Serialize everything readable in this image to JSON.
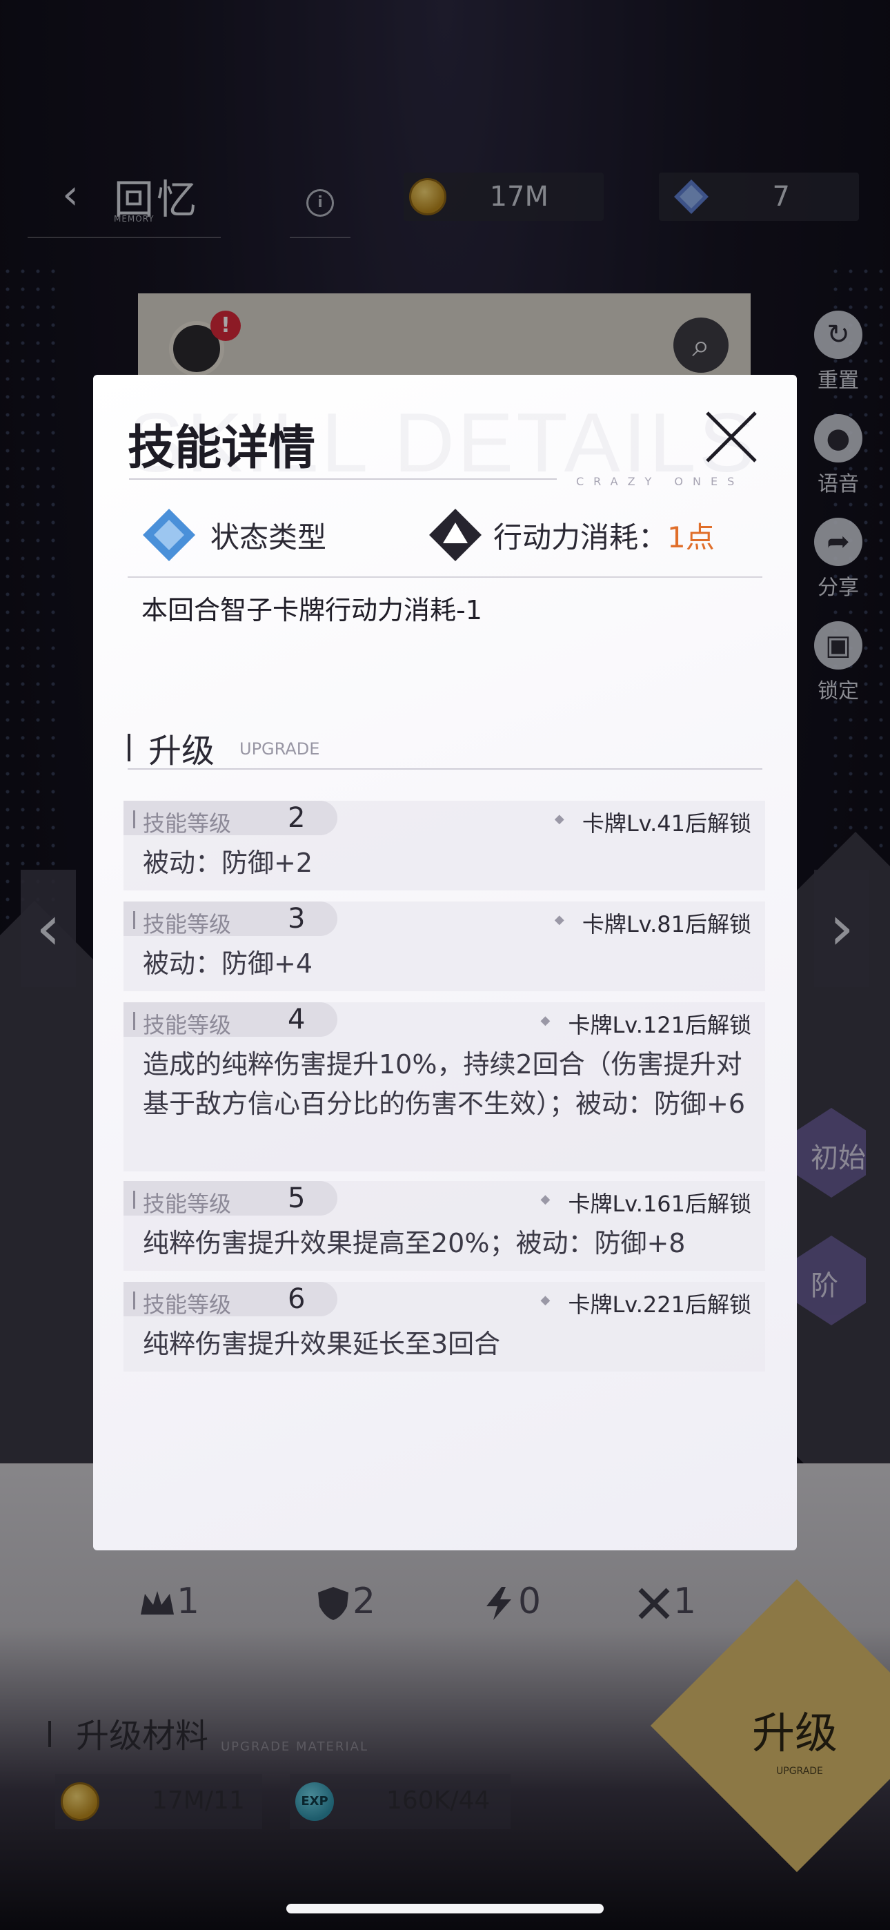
{
  "header": {
    "back_title": "回忆",
    "back_sub": "MEMORY",
    "gold": "17M",
    "gems": "7"
  },
  "side_tools": [
    {
      "label": "重置",
      "icon": "reset-icon"
    },
    {
      "label": "语音",
      "icon": "microphone-icon"
    },
    {
      "label": "分享",
      "icon": "share-icon"
    },
    {
      "label": "锁定",
      "icon": "lock-icon"
    }
  ],
  "hex_buttons": {
    "start": "初始",
    "stage": "阶"
  },
  "stats": {
    "crown": "1",
    "shield": "2",
    "bolt": "0",
    "swords": "1"
  },
  "materials": {
    "title": "升级材料",
    "sub": "UPGRADE MATERIAL",
    "gold": "17M/11",
    "exp": "160K/44",
    "exp_icon_text": "EXP"
  },
  "upgrade_button": {
    "label": "升级",
    "sub": "UPGRADE"
  },
  "modal": {
    "title": "技能详情",
    "watermark": "SKILL DETAILS",
    "sub": "CRAZY ONES",
    "type_label": "状态类型",
    "cost_label": "行动力消耗：",
    "cost_value": "1点",
    "description": "本回合智子卡牌行动力消耗-1",
    "section_title": "升级",
    "section_en": "UPGRADE",
    "levels": [
      {
        "label": "技能等级",
        "level": "2",
        "unlock": "卡牌Lv.41后解锁",
        "text": "被动：防御+2"
      },
      {
        "label": "技能等级",
        "level": "3",
        "unlock": "卡牌Lv.81后解锁",
        "text": "被动：防御+4"
      },
      {
        "label": "技能等级",
        "level": "4",
        "unlock": "卡牌Lv.121后解锁",
        "text": "造成的纯粹伤害提升10%，持续2回合（伤害提升对基于敌方信心百分比的伤害不生效）；被动：防御+6"
      },
      {
        "label": "技能等级",
        "level": "5",
        "unlock": "卡牌Lv.161后解锁",
        "text": "纯粹伤害提升效果提高至20%；被动：防御+8"
      },
      {
        "label": "技能等级",
        "level": "6",
        "unlock": "卡牌Lv.221后解锁",
        "text": "纯粹伤害提升效果延长至3回合"
      }
    ]
  },
  "colors": {
    "accent": "#e06e2a",
    "modal_bg": "#ffffff",
    "type_icon": "#4a90d9"
  }
}
